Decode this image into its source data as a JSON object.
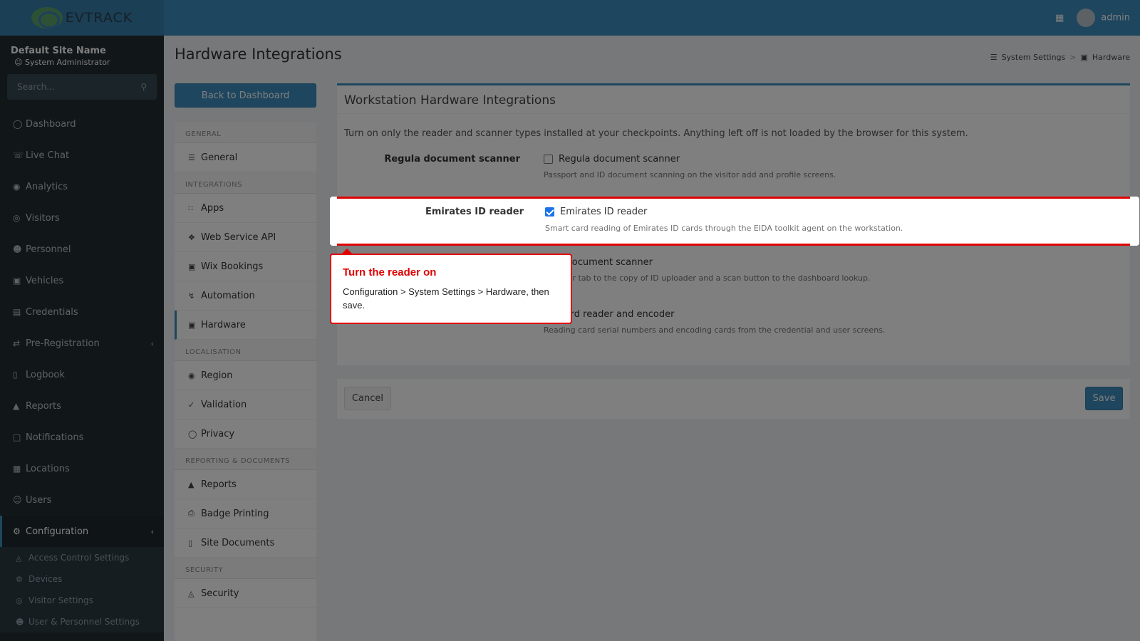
{
  "header": {
    "logo_text": "EVTRACK",
    "user_name": "admin"
  },
  "sidebar": {
    "site_name": "Default Site Name",
    "role": "System Administrator",
    "search_placeholder": "Search...",
    "items": [
      {
        "label": "Dashboard",
        "icon": "dashboard-icon"
      },
      {
        "label": "Live Chat",
        "icon": "headset-icon"
      },
      {
        "label": "Analytics",
        "icon": "target-icon"
      },
      {
        "label": "Visitors",
        "icon": "eye-icon"
      },
      {
        "label": "Personnel",
        "icon": "user-cog-icon"
      },
      {
        "label": "Vehicles",
        "icon": "car-icon"
      },
      {
        "label": "Credentials",
        "icon": "id-card-icon"
      },
      {
        "label": "Pre-Registration",
        "icon": "exchange-icon"
      },
      {
        "label": "Logbook",
        "icon": "book-icon"
      },
      {
        "label": "Reports",
        "icon": "chart-icon"
      },
      {
        "label": "Notifications",
        "icon": "chat-icon"
      },
      {
        "label": "Locations",
        "icon": "building-icon"
      },
      {
        "label": "Users",
        "icon": "users-icon"
      },
      {
        "label": "Configuration",
        "icon": "gear-icon"
      }
    ],
    "sub_items": [
      "Access Control Settings",
      "Devices",
      "Visitor Settings",
      "User & Personnel Settings"
    ]
  },
  "page": {
    "title": "Hardware Integrations",
    "breadcrumb": [
      "System Settings",
      "Hardware"
    ],
    "back_button": "Back to Dashboard"
  },
  "settings_nav": {
    "sections": [
      {
        "header": "GENERAL",
        "items": [
          "General"
        ]
      },
      {
        "header": "INTEGRATIONS",
        "items": [
          "Apps",
          "Web Service API",
          "Wix Bookings",
          "Automation",
          "Hardware"
        ]
      },
      {
        "header": "LOCALISATION",
        "items": [
          "Region",
          "Validation",
          "Privacy"
        ]
      },
      {
        "header": "REPORTING & DOCUMENTS",
        "items": [
          "Reports",
          "Badge Printing",
          "Site Documents"
        ]
      },
      {
        "header": "SECURITY",
        "items": [
          "Security"
        ]
      }
    ],
    "active": "Hardware"
  },
  "box": {
    "title": "Workstation Hardware Integrations",
    "intro": "Turn on only the reader and scanner types installed at your checkpoints. Anything left off is not loaded by the browser for this system.",
    "fields": [
      {
        "label": "Regula document scanner",
        "check_label": "Regula document scanner",
        "checked": false,
        "help": "Passport and ID document scanning on the visitor add and profile screens."
      },
      {
        "label": "Emirates ID reader",
        "check_label": "Emirates ID reader",
        "checked": true,
        "help": "Smart card reading of Emirates ID cards through the EIDA toolkit agent on the workstation."
      },
      {
        "label": "",
        "check_label": "stek document scanner",
        "checked": false,
        "help": "Scanner tab to the copy of ID uploader and a scan button to the dashboard lookup."
      },
      {
        "label": "",
        "check_label": "art card reader and encoder",
        "checked": false,
        "help": "Reading card serial numbers and encoding cards from the credential and user screens."
      }
    ]
  },
  "footer": {
    "cancel": "Cancel",
    "save": "Save"
  },
  "callout": {
    "title": "Turn the reader on",
    "body": "Configuration > System Settings > Hardware, then save."
  },
  "colors": {
    "primary": "#3c8dbc",
    "sidebar_bg": "#222d32",
    "highlight": "#e00000"
  }
}
